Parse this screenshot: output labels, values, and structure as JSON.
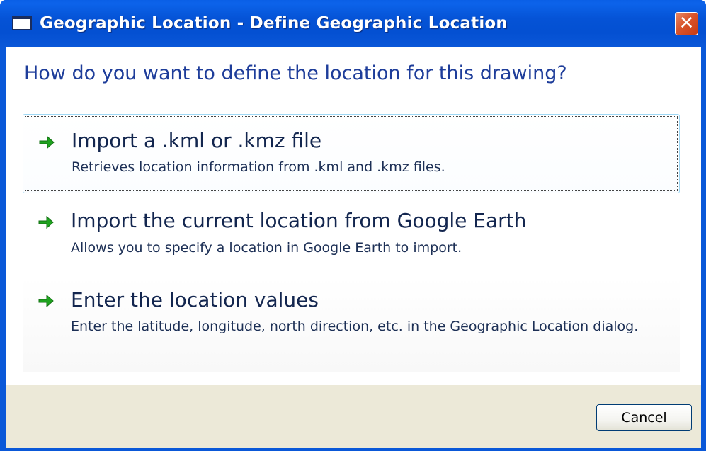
{
  "window": {
    "title": "Geographic Location - Define Geographic Location",
    "close_glyph": "✕"
  },
  "heading": "How do you want to define the location for this drawing?",
  "options": [
    {
      "title": "Import a .kml or .kmz file",
      "description": "Retrieves location information from .kml and .kmz files.",
      "icon": "green-arrow-icon",
      "focused": true
    },
    {
      "title": "Import the current location from Google Earth",
      "description": "Allows you to specify a location in Google Earth to import.",
      "icon": "green-arrow-icon",
      "focused": false
    },
    {
      "title": "Enter the location values",
      "description": "Enter the latitude, longitude, north direction, etc.  in the Geographic Location dialog.",
      "icon": "green-arrow-icon",
      "focused": false
    }
  ],
  "footer": {
    "cancel_label": "Cancel"
  },
  "colors": {
    "titlebar": "#0553d6",
    "heading": "#1e3d9a",
    "arrow": "#1fa21f",
    "footer_bg": "#ece9d8",
    "close_button": "#d9542b"
  }
}
